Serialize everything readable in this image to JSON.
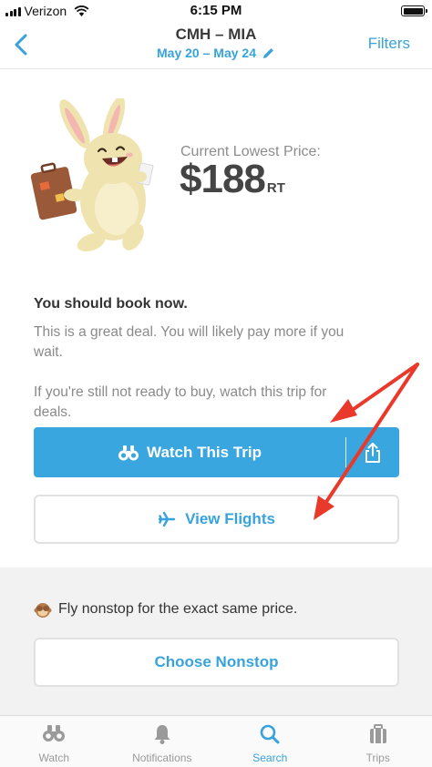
{
  "status_bar": {
    "carrier": "Verizon",
    "time": "6:15 PM"
  },
  "nav": {
    "title": "CMH – MIA",
    "dates": "May 20 – May 24",
    "filters_label": "Filters"
  },
  "price": {
    "label": "Current Lowest Price:",
    "amount": "$188",
    "suffix": "RT"
  },
  "advice": {
    "heading": "You should book now.",
    "body": "This is a great deal. You will likely pay more if you wait.",
    "watch_hint": "If you're still not ready to buy, watch this trip for deals."
  },
  "actions": {
    "watch_label": "Watch This Trip",
    "view_flights_label": "View Flights"
  },
  "nonstop": {
    "message": "Fly nonstop for the exact same price.",
    "button_label": "Choose Nonstop"
  },
  "tabs": [
    {
      "label": "Watch",
      "icon": "binoculars-icon"
    },
    {
      "label": "Notifications",
      "icon": "bell-icon"
    },
    {
      "label": "Search",
      "icon": "search-icon",
      "active": true
    },
    {
      "label": "Trips",
      "icon": "suitcase-icon"
    }
  ],
  "colors": {
    "accent": "#37a3dc",
    "button_fill": "#3aa6e0",
    "annotation_arrow": "#e8392b"
  }
}
